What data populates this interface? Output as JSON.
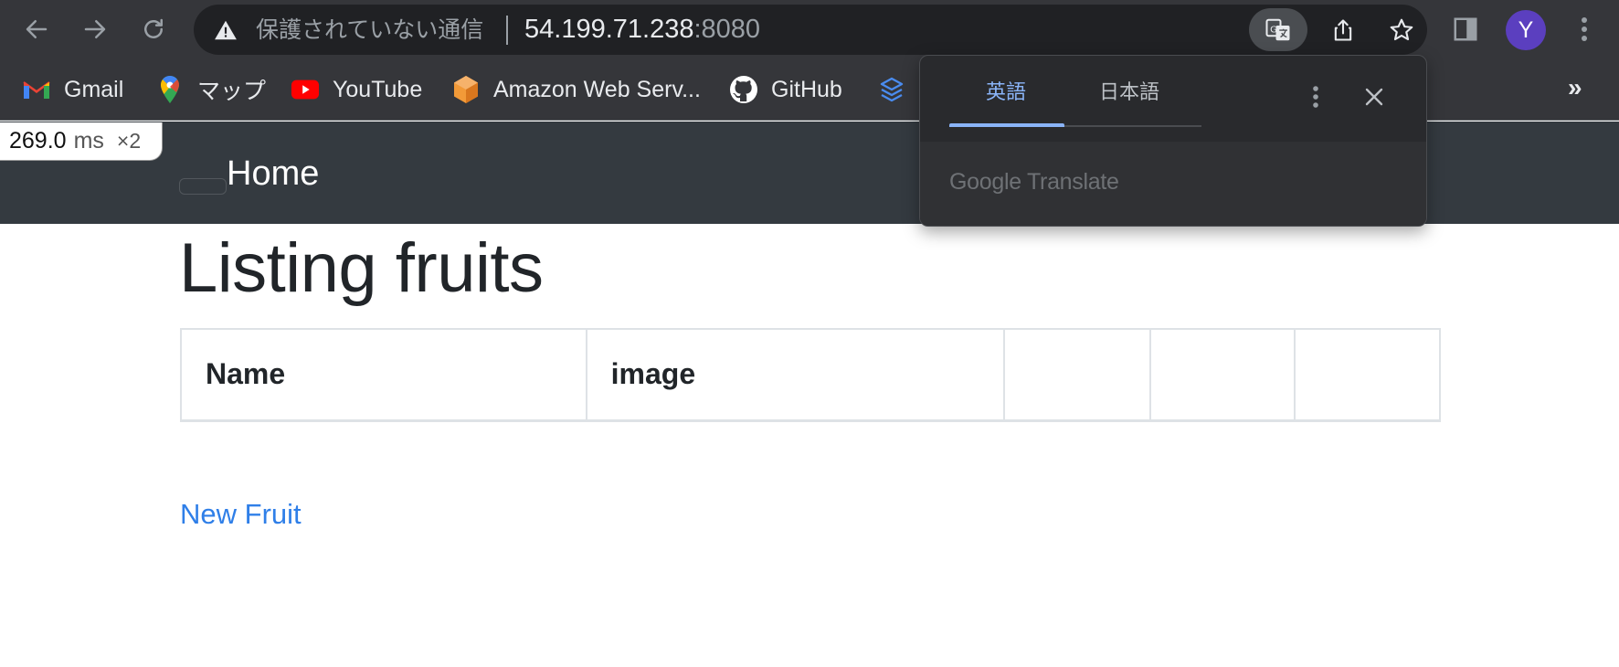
{
  "browser": {
    "security_label": "保護されていない通信",
    "url_host": "54.199.71.238",
    "url_port": ":8080",
    "profile_initial": "Y",
    "accent": "#5b3fbf"
  },
  "bookmarks": [
    {
      "label": "Gmail",
      "icon": "gmail-icon"
    },
    {
      "label": "マップ",
      "icon": "maps-icon"
    },
    {
      "label": "YouTube",
      "icon": "youtube-icon"
    },
    {
      "label": "Amazon Web Serv...",
      "icon": "aws-icon"
    },
    {
      "label": "GitHub",
      "icon": "github-icon"
    },
    {
      "label": "",
      "icon": "layers-icon"
    }
  ],
  "bookmarks_overflow": "»",
  "timer": {
    "value": "269.0",
    "unit": "ms",
    "multiplier": "×2"
  },
  "navbar": {
    "brand": "Home"
  },
  "page": {
    "title": "Listing fruits",
    "table_headers": [
      "Name",
      "image",
      "",
      "",
      ""
    ],
    "new_link": "New Fruit",
    "link_color": "#2f7fe8"
  },
  "translate_popup": {
    "tab_source": "英語",
    "tab_target": "日本語",
    "footer_brand": "Google Translate",
    "active_color": "#8ab4f8"
  }
}
